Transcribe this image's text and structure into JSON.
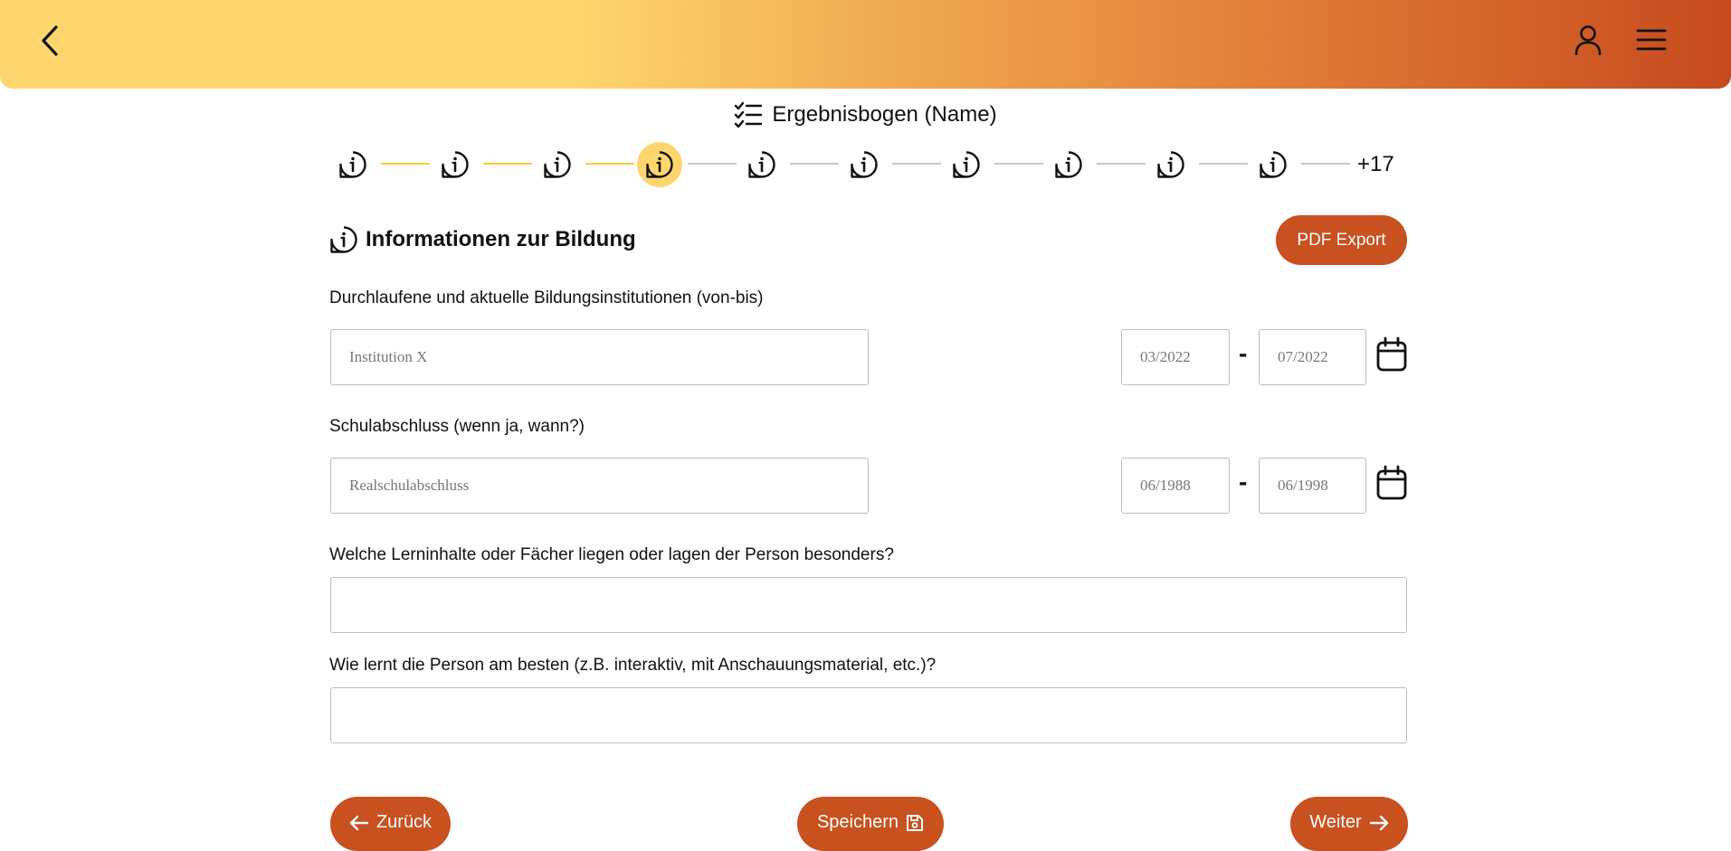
{
  "header": {
    "back_icon": "chevron-left-icon",
    "user_icon": "user-icon",
    "menu_icon": "hamburger-menu-icon",
    "gradient_start": "#ffd66e",
    "gradient_end": "#c64a1e"
  },
  "form": {
    "title": "Ergebnisbogen (Name)",
    "title_icon": "checklist-icon"
  },
  "stepper": {
    "step_icon": "info-bubble-icon",
    "total_visible_steps": 10,
    "completed_steps": 3,
    "active_step": 4,
    "more_label": "+17",
    "done_color": "#ffc93a",
    "active_color": "#ffd66e",
    "pending_color": "#c8c8c8"
  },
  "section": {
    "title": "Informationen zur Bildung",
    "icon": "info-bubble-icon",
    "pdf_label": "PDF Export"
  },
  "fields": {
    "institutions": {
      "label": "Durchlaufene und aktuelle Bildungsinstitutionen (von-bis)",
      "placeholder": "Institution X",
      "from_placeholder": "03/2022",
      "to_placeholder": "07/2022",
      "separator": "-"
    },
    "degree": {
      "label": "Schulabschluss (wenn ja, wann?)",
      "placeholder": "Realschulabschluss",
      "from_placeholder": "06/1988",
      "to_placeholder": "06/1998",
      "separator": "-"
    },
    "subjects": {
      "label": "Welche Lerninhalte oder Fächer liegen oder lagen der Person besonders?",
      "value": ""
    },
    "learning": {
      "label": "Wie lernt die Person am besten (z.B. interaktiv, mit Anschauungsmaterial, etc.)?",
      "value": ""
    }
  },
  "footer": {
    "back_label": "Zurück",
    "save_label": "Speichern",
    "next_label": "Weiter",
    "button_color": "#c8511f"
  }
}
